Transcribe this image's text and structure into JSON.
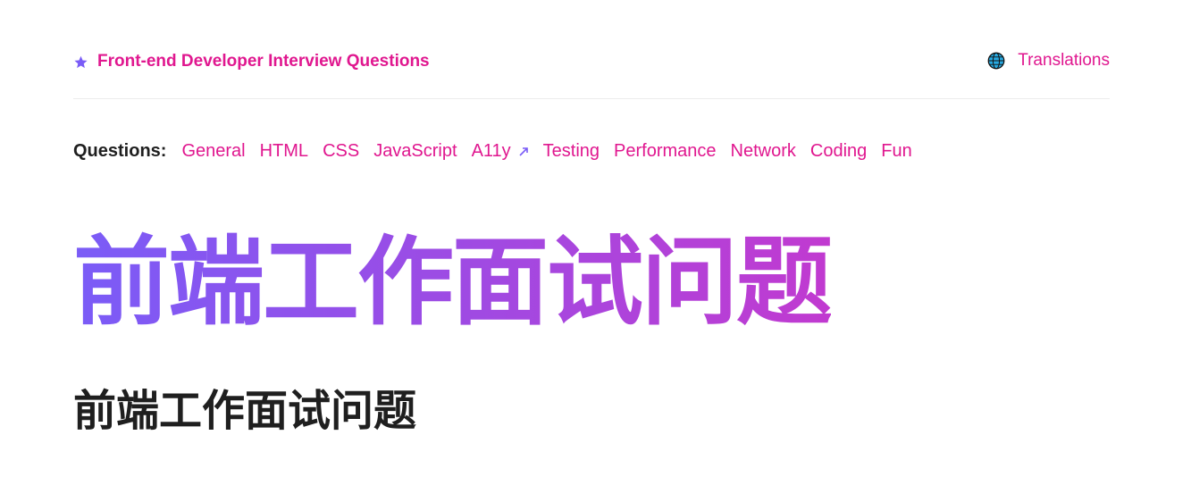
{
  "header": {
    "brand_label": "Front-end Developer Interview Questions",
    "brand_icon": "star-icon",
    "translations_label": "Translations",
    "translations_icon": "globe-icon"
  },
  "questions": {
    "label": "Questions:",
    "links": [
      {
        "label": "General"
      },
      {
        "label": "HTML"
      },
      {
        "label": "CSS"
      },
      {
        "label": "JavaScript"
      },
      {
        "label": "A11y",
        "icon": "external-link-icon"
      },
      {
        "label": "Testing"
      },
      {
        "label": "Performance"
      },
      {
        "label": "Network"
      },
      {
        "label": "Coding"
      },
      {
        "label": "Fun"
      }
    ]
  },
  "hero": {
    "title": "前端工作面试问题"
  },
  "content": {
    "heading": "前端工作面试问题"
  },
  "colors": {
    "accent": "#e0178f",
    "gradient_start": "#7a5cf7",
    "gradient_end": "#c13ad0",
    "text": "#1f1f1f"
  }
}
